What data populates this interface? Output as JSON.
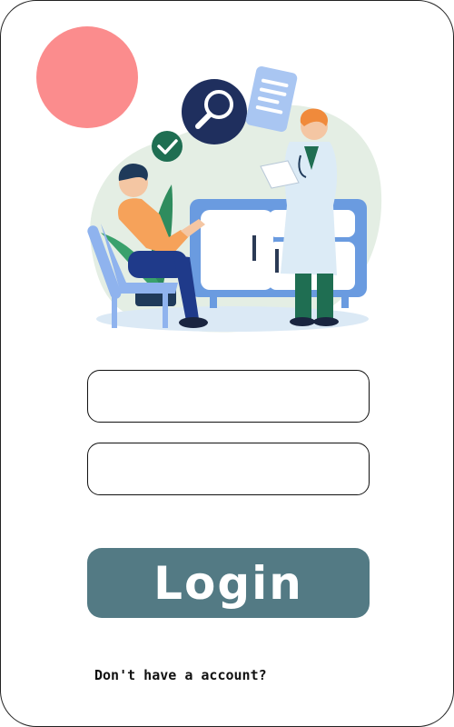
{
  "login_form": {
    "username": {
      "value": "",
      "placeholder": ""
    },
    "password": {
      "value": "",
      "placeholder": ""
    },
    "login_label": "Login",
    "signup_prompt": "Don't have a account?"
  },
  "colors": {
    "accent_circle": "#fb8c8d",
    "button": "#537a84",
    "button_text": "#ffffff",
    "border": "#111111"
  },
  "illustration": {
    "icons": [
      "search-icon",
      "document-icon",
      "checkmark-icon"
    ]
  }
}
